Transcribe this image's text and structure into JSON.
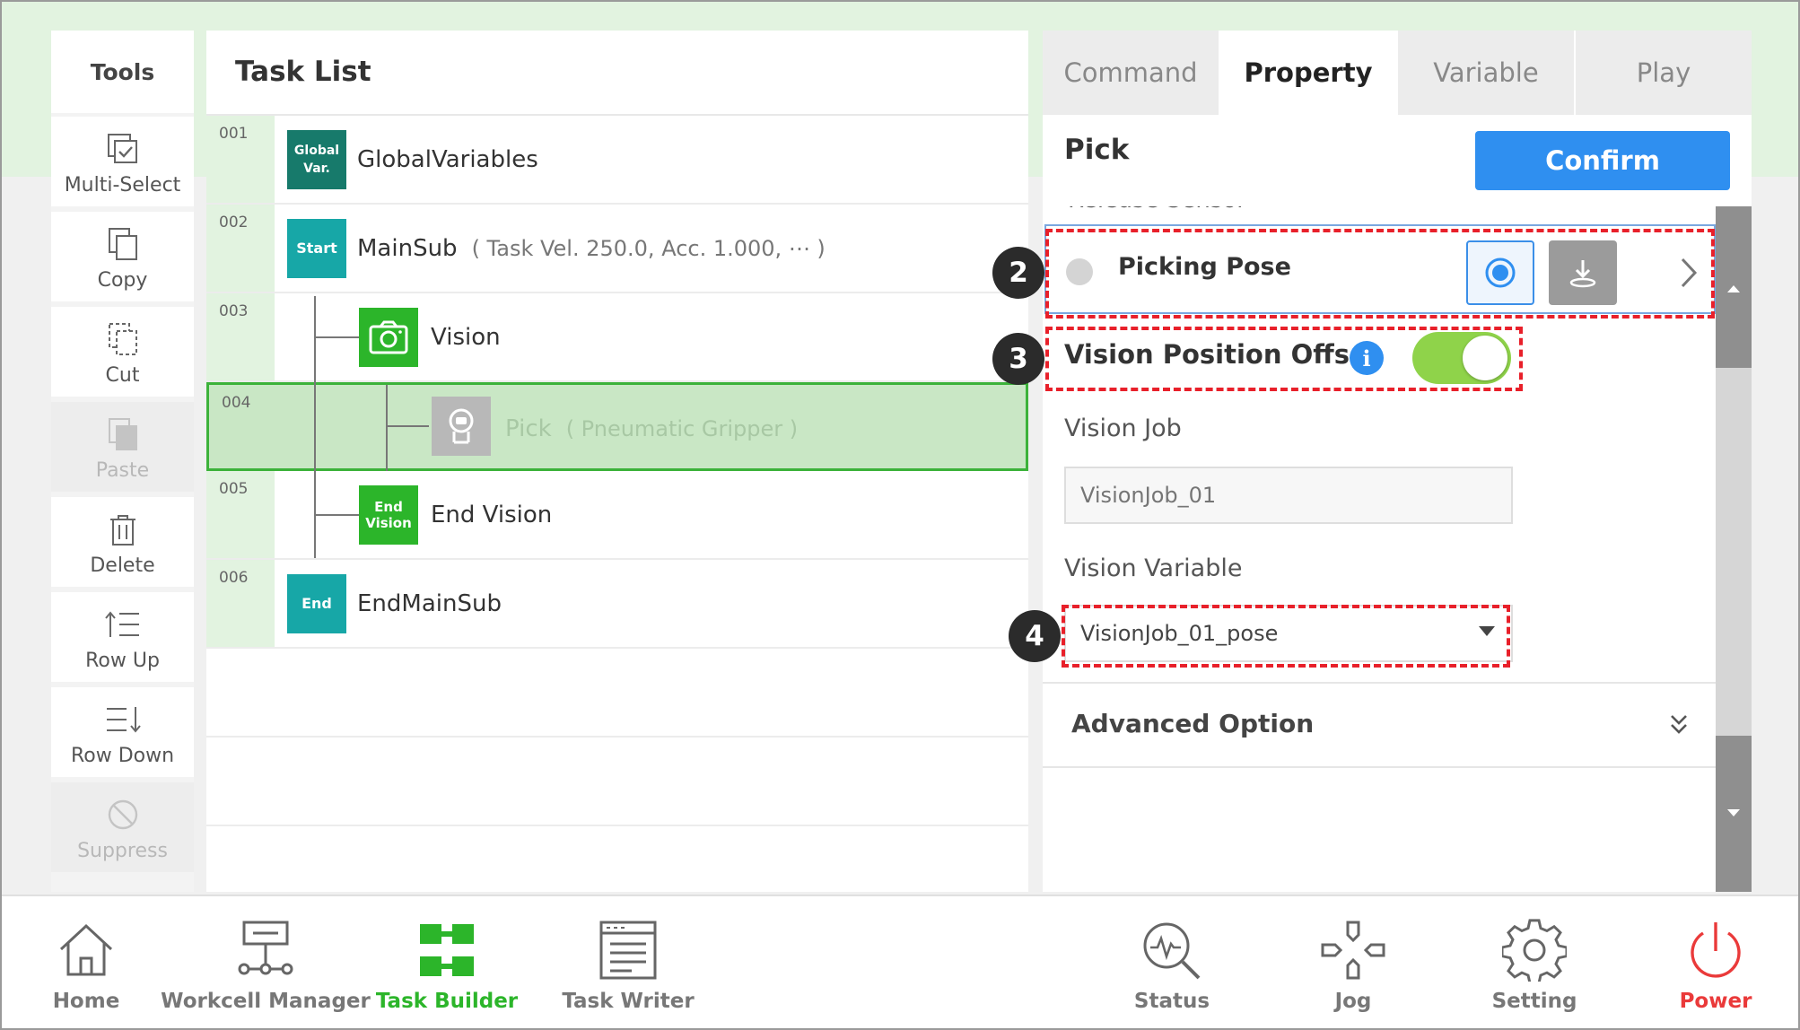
{
  "tools": {
    "title": "Tools",
    "items": [
      {
        "label": "Multi-Select",
        "icon": "multi-select-icon",
        "enabled": true
      },
      {
        "label": "Copy",
        "icon": "copy-icon",
        "enabled": true
      },
      {
        "label": "Cut",
        "icon": "cut-icon",
        "enabled": true
      },
      {
        "label": "Paste",
        "icon": "paste-icon",
        "enabled": false
      },
      {
        "label": "Delete",
        "icon": "trash-icon",
        "enabled": true
      },
      {
        "label": "Row Up",
        "icon": "row-up-icon",
        "enabled": true
      },
      {
        "label": "Row Down",
        "icon": "row-down-icon",
        "enabled": true
      },
      {
        "label": "Suppress",
        "icon": "suppress-icon",
        "enabled": false
      }
    ]
  },
  "tasklist": {
    "title": "Task List",
    "rows": [
      {
        "num": "001",
        "block": "Global Var.",
        "label": "GlobalVariables",
        "params": "",
        "color": "#177a6b"
      },
      {
        "num": "002",
        "block": "Start",
        "label": "MainSub",
        "params": "( Task Vel. 250.0, Acc. 1.000, ⋯ )",
        "color": "#17a7a7"
      },
      {
        "num": "003",
        "block": "",
        "label": "Vision",
        "params": "",
        "color": "#2cb52a"
      },
      {
        "num": "004",
        "block": "",
        "label": "Pick",
        "params": "( Pneumatic Gripper )",
        "color": "#b8b8b8",
        "selected": true
      },
      {
        "num": "005",
        "block": "End Vision",
        "label": "End Vision",
        "params": "",
        "color": "#2cb52a"
      },
      {
        "num": "006",
        "block": "End",
        "label": "EndMainSub",
        "params": "",
        "color": "#17a7a7"
      }
    ]
  },
  "panel": {
    "tabs": [
      {
        "label": "Command",
        "active": false
      },
      {
        "label": "Property",
        "active": true
      },
      {
        "label": "Variable",
        "active": false
      },
      {
        "label": "Play",
        "active": false
      }
    ],
    "title": "Pick",
    "confirm_label": "Confirm",
    "release_sensor_label": "Release Sensor",
    "picking_pose_label": "Picking Pose",
    "vision_offset_label": "Vision Position Offset",
    "vision_offset_info": "i",
    "vision_offset_enabled": true,
    "vision_job_label": "Vision Job",
    "vision_job_placeholder": "VisionJob_01",
    "vision_variable_label": "Vision Variable",
    "vision_variable_value": "VisionJob_01_pose",
    "advanced_label": "Advanced Option"
  },
  "callouts": [
    "2",
    "3",
    "4"
  ],
  "nav": {
    "items": [
      {
        "label": "Home",
        "icon": "home-icon"
      },
      {
        "label": "Workcell Manager",
        "icon": "workcell-icon"
      },
      {
        "label": "Task Builder",
        "icon": "task-builder-icon",
        "active": true
      },
      {
        "label": "Task Writer",
        "icon": "task-writer-icon"
      },
      {
        "label": "Status",
        "icon": "status-icon"
      },
      {
        "label": "Jog",
        "icon": "jog-icon"
      },
      {
        "label": "Setting",
        "icon": "gear-icon"
      },
      {
        "label": "Power",
        "icon": "power-icon"
      }
    ]
  },
  "colors": {
    "accent_green": "#2cb52a",
    "accent_blue": "#2f8ff0",
    "highlight_red": "#e8202a",
    "power_red": "#ea3a3a",
    "selected_row": "#c9e7c5"
  }
}
